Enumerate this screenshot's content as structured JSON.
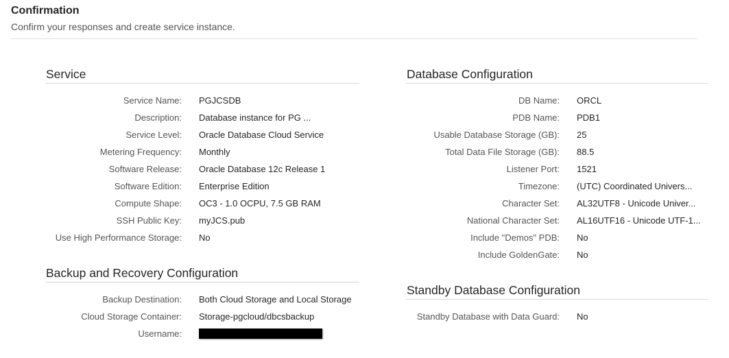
{
  "header": {
    "title": "Confirmation",
    "subtitle": "Confirm your responses and create service instance."
  },
  "service": {
    "title": "Service",
    "rows": [
      {
        "label": "Service Name:",
        "value": "PGJCSDB"
      },
      {
        "label": "Description:",
        "value": "Database instance for PG ..."
      },
      {
        "label": "Service Level:",
        "value": "Oracle Database Cloud Service"
      },
      {
        "label": "Metering Frequency:",
        "value": "Monthly"
      },
      {
        "label": "Software Release:",
        "value": "Oracle Database 12c Release 1"
      },
      {
        "label": "Software Edition:",
        "value": "Enterprise Edition"
      },
      {
        "label": "Compute Shape:",
        "value": "OC3 - 1.0 OCPU, 7.5 GB RAM"
      },
      {
        "label": "SSH Public Key:",
        "value": "myJCS.pub"
      },
      {
        "label": "Use High Performance Storage:",
        "value": "No"
      }
    ]
  },
  "backup": {
    "title": "Backup and Recovery Configuration",
    "rows": [
      {
        "label": "Backup Destination:",
        "value": "Both Cloud Storage and Local Storage"
      },
      {
        "label": "Cloud Storage Container:",
        "value": "Storage-pgcloud/dbcsbackup"
      },
      {
        "label": "Username:"
      }
    ]
  },
  "database": {
    "title": "Database Configuration",
    "rows": [
      {
        "label": "DB Name:",
        "value": "ORCL"
      },
      {
        "label": "PDB Name:",
        "value": "PDB1"
      },
      {
        "label": "Usable Database Storage (GB):",
        "value": "25"
      },
      {
        "label": "Total Data File Storage (GB):",
        "value": "88.5"
      },
      {
        "label": "Listener Port:",
        "value": "1521"
      },
      {
        "label": "Timezone:",
        "value": "(UTC) Coordinated Univers..."
      },
      {
        "label": "Character Set:",
        "value": "AL32UTF8 - Unicode Univer..."
      },
      {
        "label": "National Character Set:",
        "value": "AL16UTF16 - Unicode UTF-1..."
      },
      {
        "label": "Include \"Demos\" PDB:",
        "value": "No"
      },
      {
        "label": "Include GoldenGate:",
        "value": "No"
      }
    ]
  },
  "standby": {
    "title": "Standby Database Configuration",
    "rows": [
      {
        "label": "Standby Database with Data Guard:",
        "value": "No"
      }
    ]
  }
}
